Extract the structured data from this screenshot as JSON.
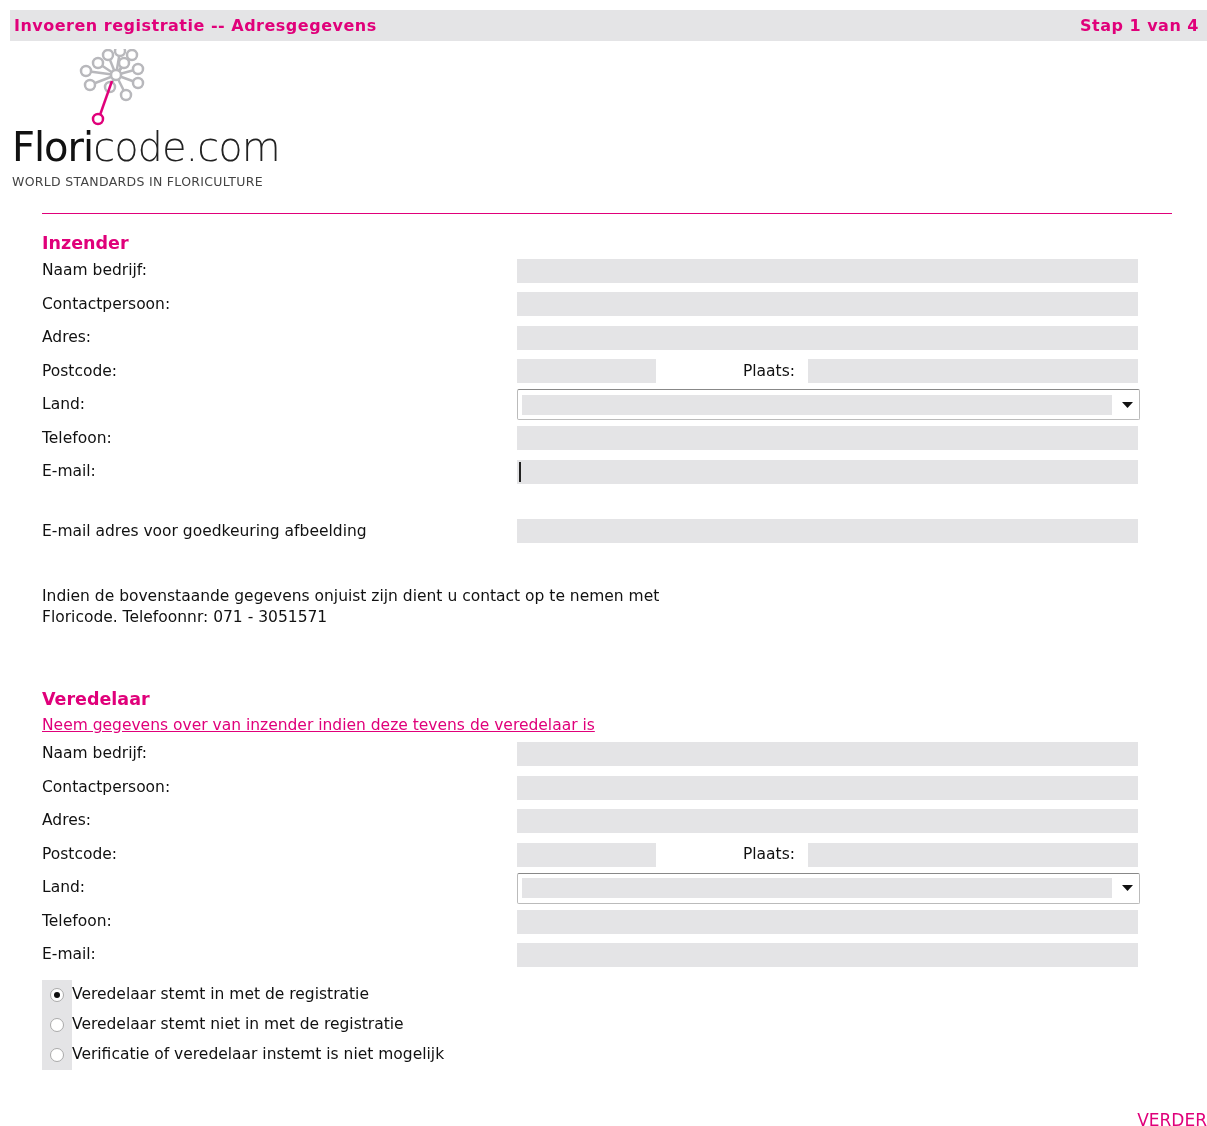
{
  "header": {
    "title": "Invoeren registratie -- Adresgegevens",
    "step": "Stap 1 van 4"
  },
  "logo": {
    "name_strong": "Flori",
    "name_light": "code.com",
    "tagline": "WORLD STANDARDS IN FLORICULTURE"
  },
  "sections": [
    {
      "title": "Inzender",
      "rows": [
        {
          "kind": "field",
          "label": "Naam bedrijf:",
          "focused": false
        },
        {
          "kind": "field",
          "label": "Contactpersoon:",
          "focused": false
        },
        {
          "kind": "field",
          "label": "Adres:",
          "focused": false
        },
        {
          "kind": "split",
          "label": "Postcode:",
          "second_label": "Plaats:"
        },
        {
          "kind": "select",
          "label": "Land:"
        },
        {
          "kind": "field",
          "label": "Telefoon:",
          "focused": false
        },
        {
          "kind": "field",
          "label": "E-mail:",
          "focused": true
        },
        {
          "kind": "gap"
        },
        {
          "kind": "field",
          "label": "E-mail adres voor goedkeuring afbeelding",
          "focused": false
        },
        {
          "kind": "note",
          "text": "Indien de bovenstaande gegevens onjuist zijn dient u contact op te nemen met Floricode. Telefoonnr: 071 - 3051571"
        }
      ]
    },
    {
      "title": "Veredelaar",
      "rows": [
        {
          "kind": "link",
          "text": "Neem gegevens over van inzender indien deze tevens de veredelaar is"
        },
        {
          "kind": "field",
          "label": "Naam bedrijf:",
          "focused": false
        },
        {
          "kind": "field",
          "label": "Contactpersoon:",
          "focused": false
        },
        {
          "kind": "field",
          "label": "Adres:",
          "focused": false
        },
        {
          "kind": "split",
          "label": "Postcode:",
          "second_label": "Plaats:"
        },
        {
          "kind": "select",
          "label": "Land:"
        },
        {
          "kind": "field",
          "label": "Telefoon:",
          "focused": false
        },
        {
          "kind": "field",
          "label": "E-mail:",
          "focused": false
        },
        {
          "kind": "radios",
          "options": [
            {
              "label": "Veredelaar stemt in met de registratie",
              "selected": true
            },
            {
              "label": "Veredelaar stemt niet in met de registratie",
              "selected": false
            },
            {
              "label": "Verificatie of veredelaar instemt is niet mogelijk",
              "selected": false
            }
          ]
        }
      ]
    }
  ],
  "next_link": "VERDER"
}
